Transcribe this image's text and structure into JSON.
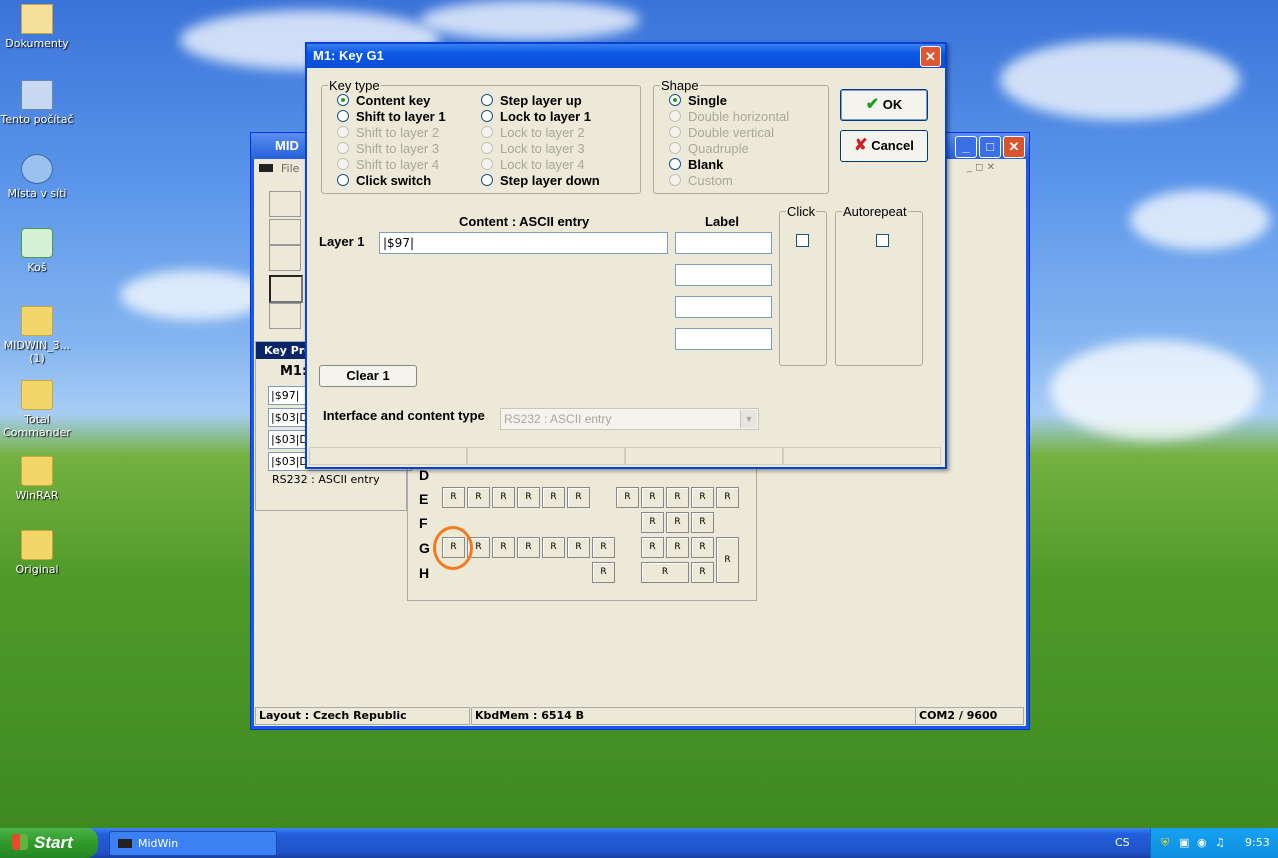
{
  "desktop": {
    "icons": [
      {
        "label": "Dokumenty",
        "icon": "documents-folder-icon"
      },
      {
        "label": "Tento počítač",
        "icon": "my-computer-icon"
      },
      {
        "label": "Místa v síti",
        "icon": "network-places-icon"
      },
      {
        "label": "Koš",
        "icon": "recycle-bin-icon"
      },
      {
        "label": "MIDWIN_3... (1)",
        "icon": "folder-icon"
      },
      {
        "label": "Total Commander",
        "icon": "folder-icon"
      },
      {
        "label": "WinRAR",
        "icon": "folder-icon"
      },
      {
        "label": "Original",
        "icon": "folder-icon"
      }
    ]
  },
  "mainwindow": {
    "title": "MID",
    "menu_file": "File",
    "panel_header": "Key Pro",
    "panel_key": "M1:",
    "fields": [
      "|$97|",
      "|$03|D",
      "|$03|D",
      "|$03|D"
    ],
    "panel_type": "RS232 : ASCII entry",
    "rows": [
      "D",
      "E",
      "F",
      "G",
      "H"
    ],
    "key_label": "R",
    "status": {
      "layout": "Layout : Czech Republic",
      "mem": "KbdMem : 6514 B",
      "port": "COM2 / 9600"
    }
  },
  "dialog": {
    "title": "M1: Key G1",
    "keytype": {
      "legend": "Key type",
      "options_left": [
        {
          "label": "Content key",
          "checked": true,
          "disabled": false
        },
        {
          "label": "Shift to layer 1",
          "checked": false,
          "disabled": false
        },
        {
          "label": "Shift to layer 2",
          "checked": false,
          "disabled": true
        },
        {
          "label": "Shift to layer 3",
          "checked": false,
          "disabled": true
        },
        {
          "label": "Shift to layer 4",
          "checked": false,
          "disabled": true
        },
        {
          "label": "Click switch",
          "checked": false,
          "disabled": false
        }
      ],
      "options_right": [
        {
          "label": "Step layer up",
          "checked": false,
          "disabled": false
        },
        {
          "label": "Lock to layer 1",
          "checked": false,
          "disabled": false
        },
        {
          "label": "Lock to layer 2",
          "checked": false,
          "disabled": true
        },
        {
          "label": "Lock to layer 3",
          "checked": false,
          "disabled": true
        },
        {
          "label": "Lock to layer 4",
          "checked": false,
          "disabled": true
        },
        {
          "label": "Step layer down",
          "checked": false,
          "disabled": false
        }
      ]
    },
    "shape": {
      "legend": "Shape",
      "options": [
        {
          "label": "Single",
          "checked": true,
          "disabled": false
        },
        {
          "label": "Double horizontal",
          "checked": false,
          "disabled": true
        },
        {
          "label": "Double vertical",
          "checked": false,
          "disabled": true
        },
        {
          "label": "Quadruple",
          "checked": false,
          "disabled": true
        },
        {
          "label": "Blank",
          "checked": false,
          "disabled": false
        },
        {
          "label": "Custom",
          "checked": false,
          "disabled": true
        }
      ]
    },
    "ok_label": "OK",
    "cancel_label": "Cancel",
    "content_header": "Content : ASCII entry",
    "label_header": "Label",
    "click_header": "Click",
    "autorepeat_header": "Autorepeat",
    "layer1_label": "Layer 1",
    "layer1_value": "|$97|",
    "clear_label": "Clear 1",
    "interface_label": "Interface and content type",
    "interface_value": "RS232  : ASCII entry"
  },
  "taskbar": {
    "start_label": "Start",
    "task_label": "MidWin",
    "lang": "CS",
    "clock": "9:53"
  }
}
